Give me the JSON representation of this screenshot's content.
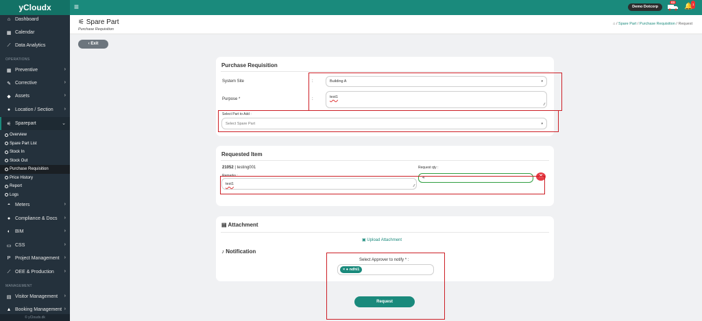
{
  "app": {
    "brand": "yCloudx",
    "user": "Demo Dotcorp",
    "truck_badge": "03",
    "bell_badge": "1"
  },
  "sidebar": {
    "top_items": [
      {
        "label": "Dashboard",
        "icon": "home-icon"
      },
      {
        "label": "Calendar",
        "icon": "calendar-icon"
      },
      {
        "label": "Data Analytics",
        "icon": "chart-icon"
      }
    ],
    "operations_label": "OPERATIONS",
    "ops_items": [
      {
        "label": "Preventive",
        "icon": "calendar-icon"
      },
      {
        "label": "Corrective",
        "icon": "wrench-icon"
      },
      {
        "label": "Assets",
        "icon": "tag-icon"
      },
      {
        "label": "Location / Section",
        "icon": "location-icon"
      },
      {
        "label": "Sparepart",
        "icon": "sparepart-icon"
      }
    ],
    "sparepart_sub": [
      "Overview",
      "Spare Part List",
      "Stock In",
      "Stock Out",
      "Purchase Requisition",
      "Price History",
      "Report",
      "Logs"
    ],
    "more_items": [
      {
        "label": "Meters",
        "icon": "gauge-icon"
      },
      {
        "label": "Compliance & Docs",
        "icon": "compliance-icon"
      },
      {
        "label": "BIM",
        "icon": "bim-icon"
      },
      {
        "label": "CSS",
        "icon": "monitor-icon"
      },
      {
        "label": "Project Management",
        "icon": "project-icon"
      },
      {
        "label": "OEE & Production",
        "icon": "chart-icon"
      }
    ],
    "management_label": "MANAGEMENT",
    "mgmt_items": [
      {
        "label": "Visitor Management",
        "icon": "id-card-icon"
      },
      {
        "label": "Booking Management",
        "icon": "booking-icon"
      }
    ],
    "footer": "© yCloudx.dk"
  },
  "header": {
    "title": "Spare Part",
    "subtitle": "Purchase Requisition",
    "crumbs": [
      "Spare Part",
      "Purchase Requisition",
      "Request"
    ],
    "exit_label": "Exit"
  },
  "pr_card": {
    "title": "Purchase Requisition",
    "system_site_label": "System Site",
    "colon": ":",
    "system_site_value": "Building A",
    "purpose_label": "Purpose *",
    "purpose_value": "test1",
    "select_part_label": "Select Part to Add :",
    "select_part_placeholder": "Select Spare Part"
  },
  "req_card": {
    "title": "Requested Item",
    "item_code": "21052",
    "item_name": "| testing001",
    "request_qty_label": "Request qty :",
    "request_qty_value": "4",
    "remarks_label": "Remarks :",
    "remarks_value": "test1"
  },
  "att_card": {
    "attachment_title": "Attachment",
    "upload_label": "Upload Attachment",
    "notification_title": "Notification",
    "approver_label": "Select Approver to notify * :",
    "approver_tag": "ndhi1",
    "request_label": "Request"
  },
  "colors": {
    "accent": "#1a8a7c",
    "sidebar": "#24313c",
    "highlight": "#cc1c23"
  }
}
